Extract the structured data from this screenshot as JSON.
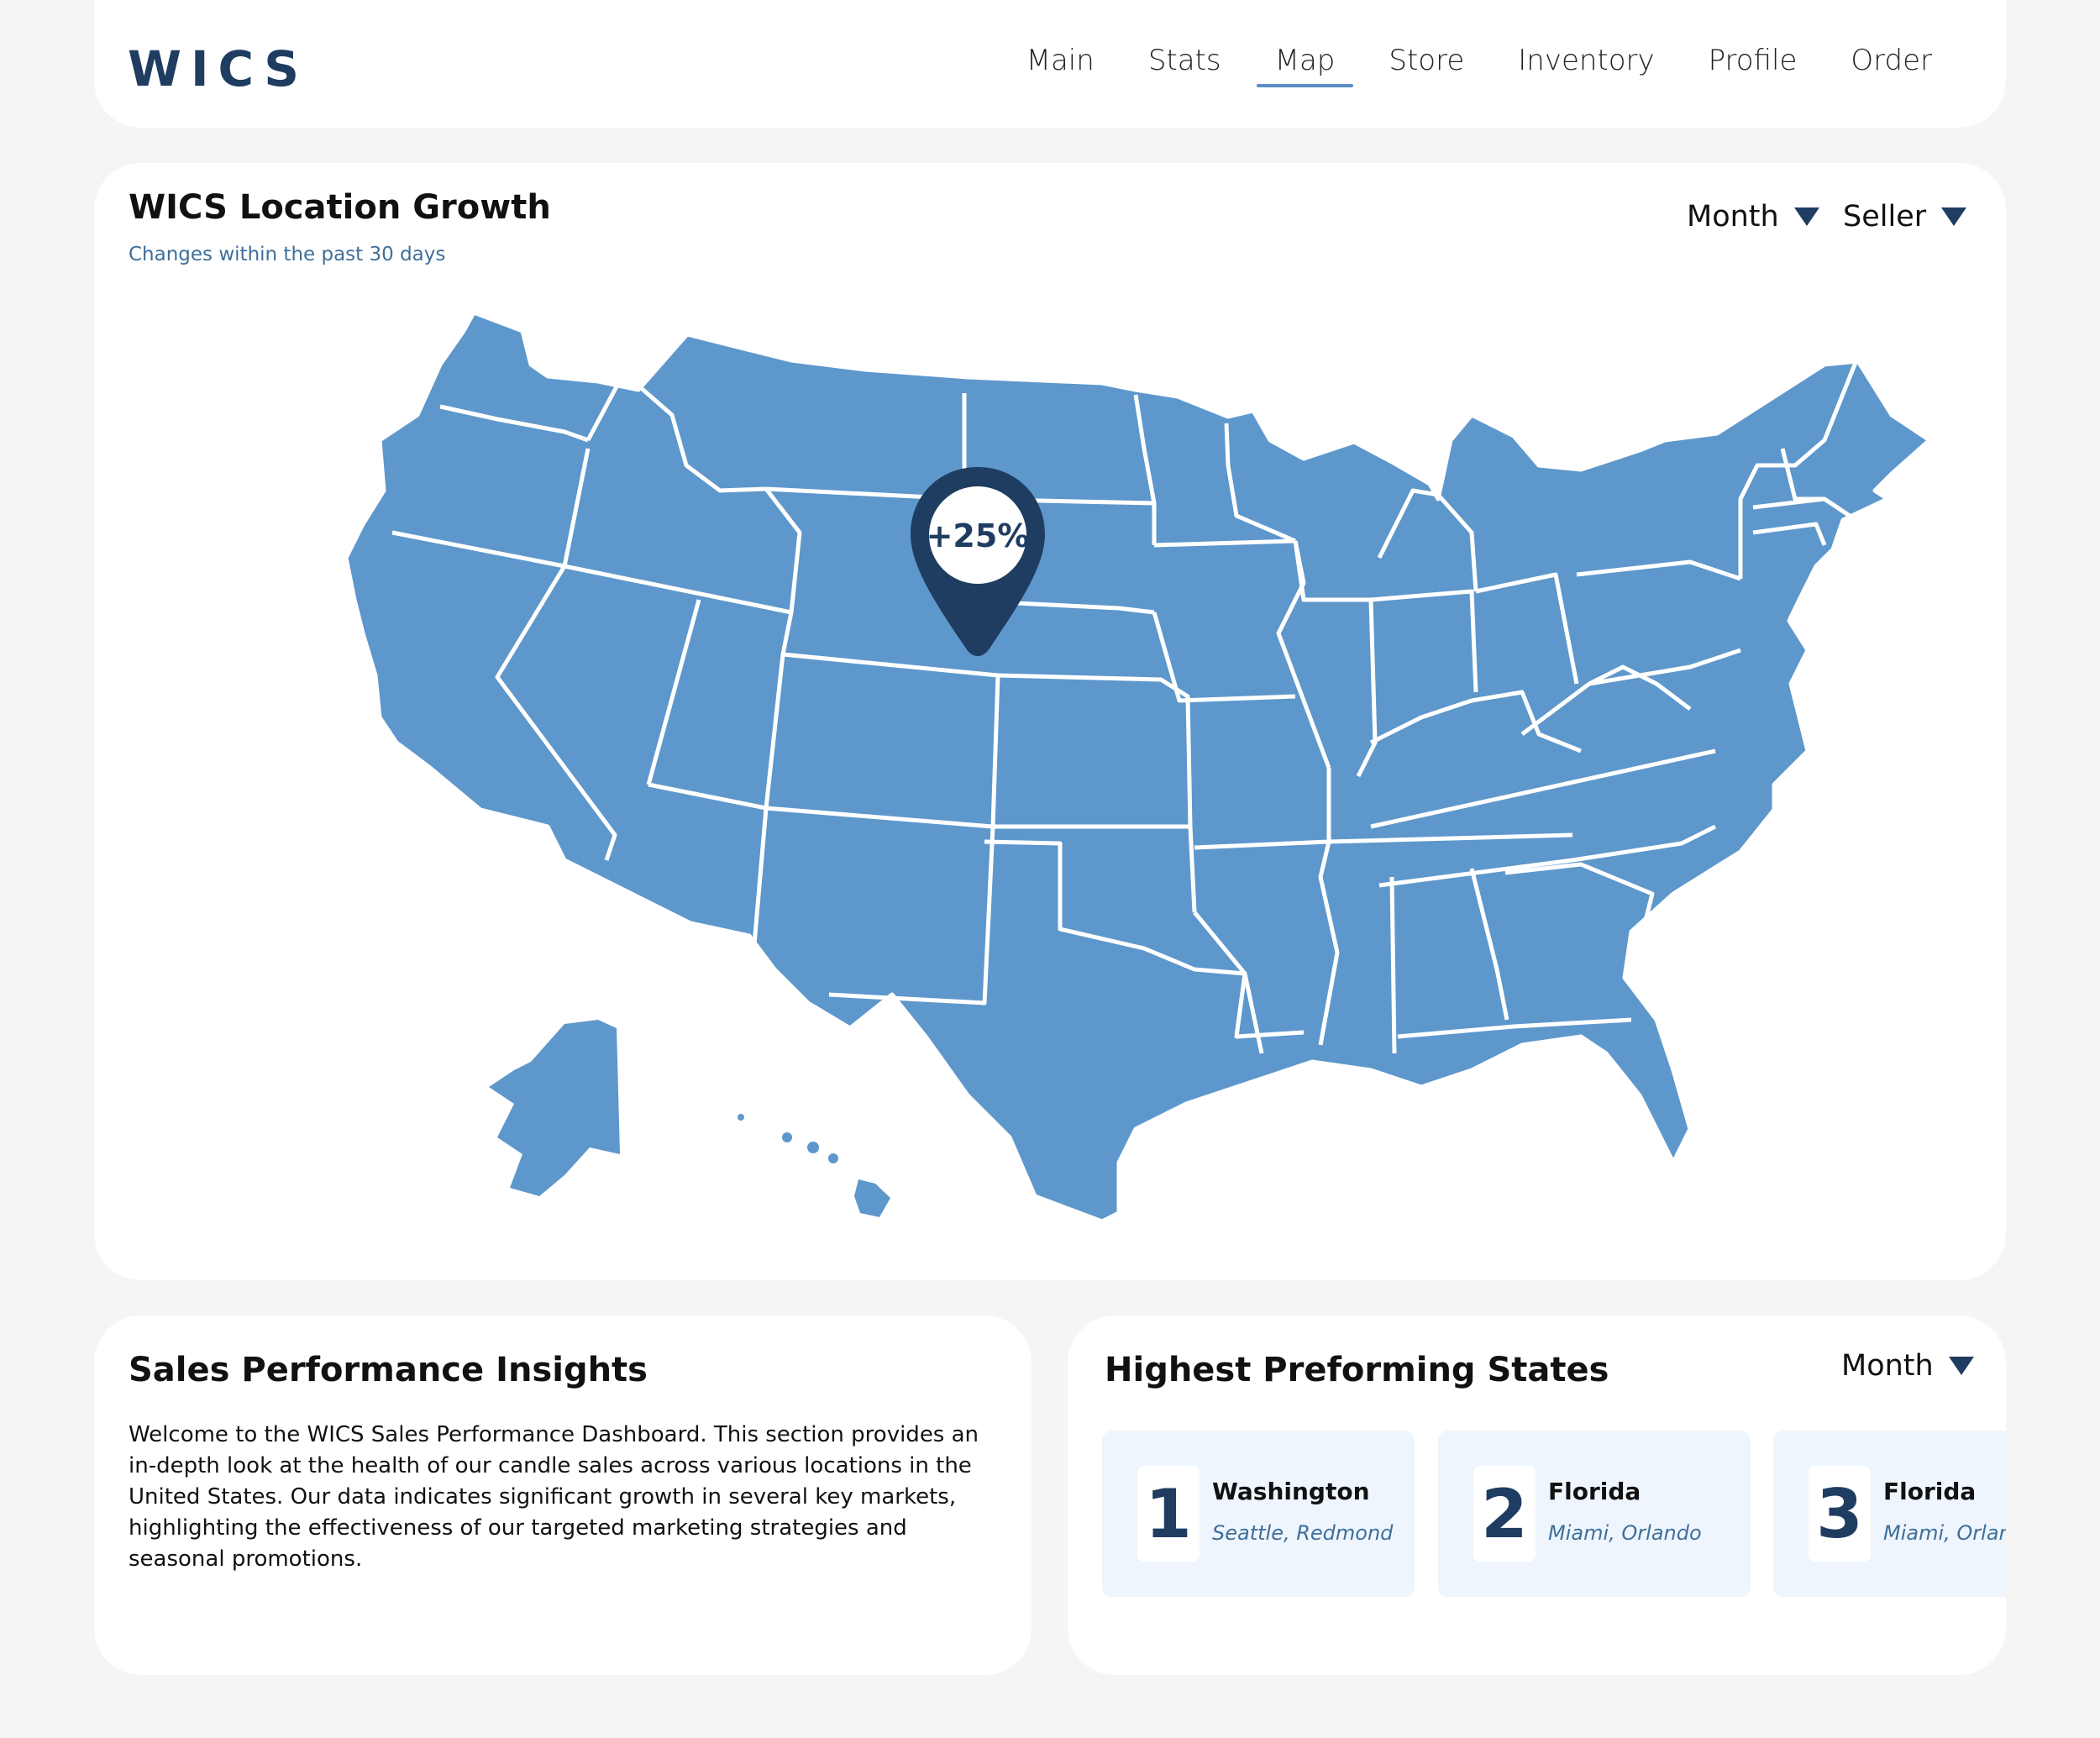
{
  "header": {
    "logo": "WICS",
    "nav": [
      "Main",
      "Stats",
      "Map",
      "Store",
      "Inventory",
      "Profile",
      "Order"
    ],
    "active_nav": "Map"
  },
  "map_card": {
    "title": "WICS Location Growth",
    "subtitle": "Changes within the past 30 days",
    "filter_month": "Month",
    "filter_seller": "Seller",
    "marker_value": "+25%",
    "map_color": "#5e97cb",
    "marker_color": "#1f3d61"
  },
  "insights": {
    "title": "Sales Performance Insights",
    "body": "Welcome to the WICS Sales Performance Dashboard. This section provides an in-depth look at the health of our candle sales across various locations in the United States. Our data indicates significant growth in several key markets, highlighting the effectiveness of our targeted marketing strategies and seasonal promotions."
  },
  "top_states": {
    "title": "Highest Preforming States",
    "filter": "Month",
    "items": [
      {
        "rank": "1",
        "state": "Washington",
        "cities": "Seattle, Redmond"
      },
      {
        "rank": "2",
        "state": "Florida",
        "cities": "Miami, Orlando"
      },
      {
        "rank": "3",
        "state": "Florida",
        "cities": "Miami, Orlando"
      }
    ]
  }
}
